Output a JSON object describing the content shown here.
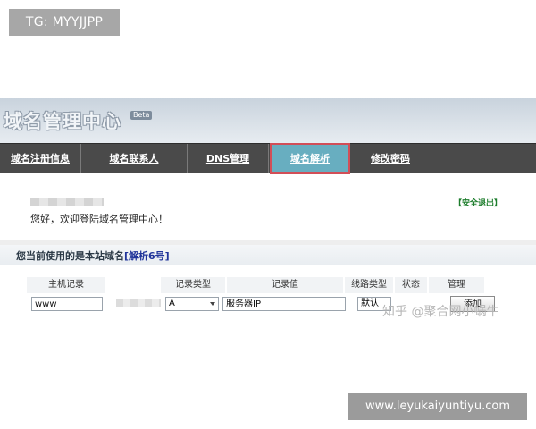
{
  "tg_badge": "TG: MYYJJPP",
  "site_badge": "www.leyukaiyuntiyu.com",
  "header": {
    "logo": "域名管理中心",
    "beta": "Beta"
  },
  "nav": [
    {
      "label": "域名注册信息"
    },
    {
      "label": "域名联系人"
    },
    {
      "label": "DNS管理"
    },
    {
      "label": "域名解析"
    },
    {
      "label": "修改密码"
    }
  ],
  "welcome": {
    "greeting": "您好，欢迎登陆域名管理中心！",
    "logout": "【安全退出】"
  },
  "domain_bar": {
    "text": "您当前使用的是本站域名",
    "link": "[解析6号]"
  },
  "table": {
    "headers": [
      "主机记录",
      "记录类型",
      "记录值",
      "线路类型",
      "状态",
      "管理"
    ],
    "host_value": "www",
    "type_value": "A",
    "record_value": "服务器IP",
    "line_value": "默认",
    "manage_label": "添加"
  },
  "watermark": "知乎 @聚合网小蜗牛"
}
